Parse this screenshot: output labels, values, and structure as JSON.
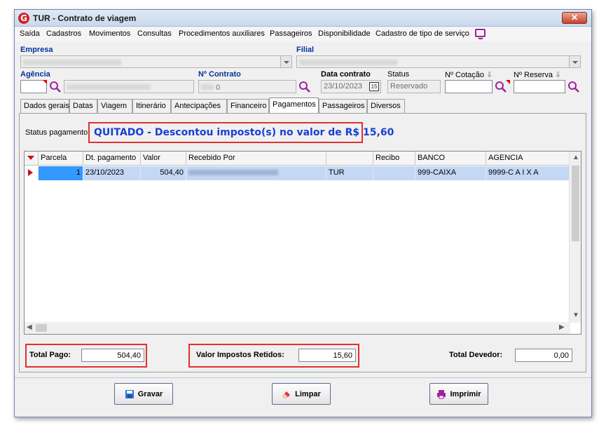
{
  "window": {
    "title": "TUR - Contrato de viagem",
    "close_label": "✕",
    "logo_letter": "G"
  },
  "menu": [
    "Saída",
    "Cadastros",
    "Movimentos",
    "Consultas",
    "Procedimentos auxiliares",
    "Passageiros",
    "Disponibilidade",
    "Cadastro de tipo de serviço"
  ],
  "header": {
    "empresa_label": "Empresa",
    "filial_label": "Filial",
    "agencia_label": "Agência",
    "contrato_label": "Nº Contrato",
    "contrato_value": "0",
    "data_contrato_label": "Data contrato",
    "data_contrato_value": "23/10/2023",
    "calendar_day": "15",
    "status_label": "Status",
    "status_value": "Reservado",
    "cotacao_label": "Nº Cotação",
    "reserva_label": "Nº Reserva"
  },
  "tabs": [
    "Dados gerais",
    "Datas",
    "Viagem",
    "Itinerário",
    "Antecipações",
    "Financeiro",
    "Pagamentos",
    "Passageiros",
    "Diversos"
  ],
  "active_tab": "Pagamentos",
  "payment": {
    "status_label": "Status pagamento:",
    "status_value": "QUITADO - Descontou imposto(s) no valor de R$ 15,60"
  },
  "grid": {
    "columns": [
      "Parcela",
      "Dt. pagamento",
      "Valor",
      "Recebido Por",
      "",
      "Recibo",
      "BANCO",
      "AGENCIA"
    ],
    "rows": [
      {
        "parcela": "1",
        "dt_pagamento": "23/10/2023",
        "valor": "504,40",
        "recebido_por": "",
        "tipo": "TUR",
        "recibo": "",
        "banco": "999-CAIXA",
        "agencia": "9999-C A I X A"
      }
    ]
  },
  "totals": {
    "total_pago_label": "Total Pago:",
    "total_pago_value": "504,40",
    "impostos_label": "Valor Impostos Retidos:",
    "impostos_value": "15,60",
    "devedor_label": "Total Devedor:",
    "devedor_value": "0,00"
  },
  "buttons": {
    "gravar": "Gravar",
    "limpar": "Limpar",
    "imprimir": "Imprimir"
  },
  "colors": {
    "accent_red": "#e03030",
    "status_blue": "#1a3fd1",
    "label_blue": "#003399",
    "selected_row": "#c4d8f5"
  }
}
